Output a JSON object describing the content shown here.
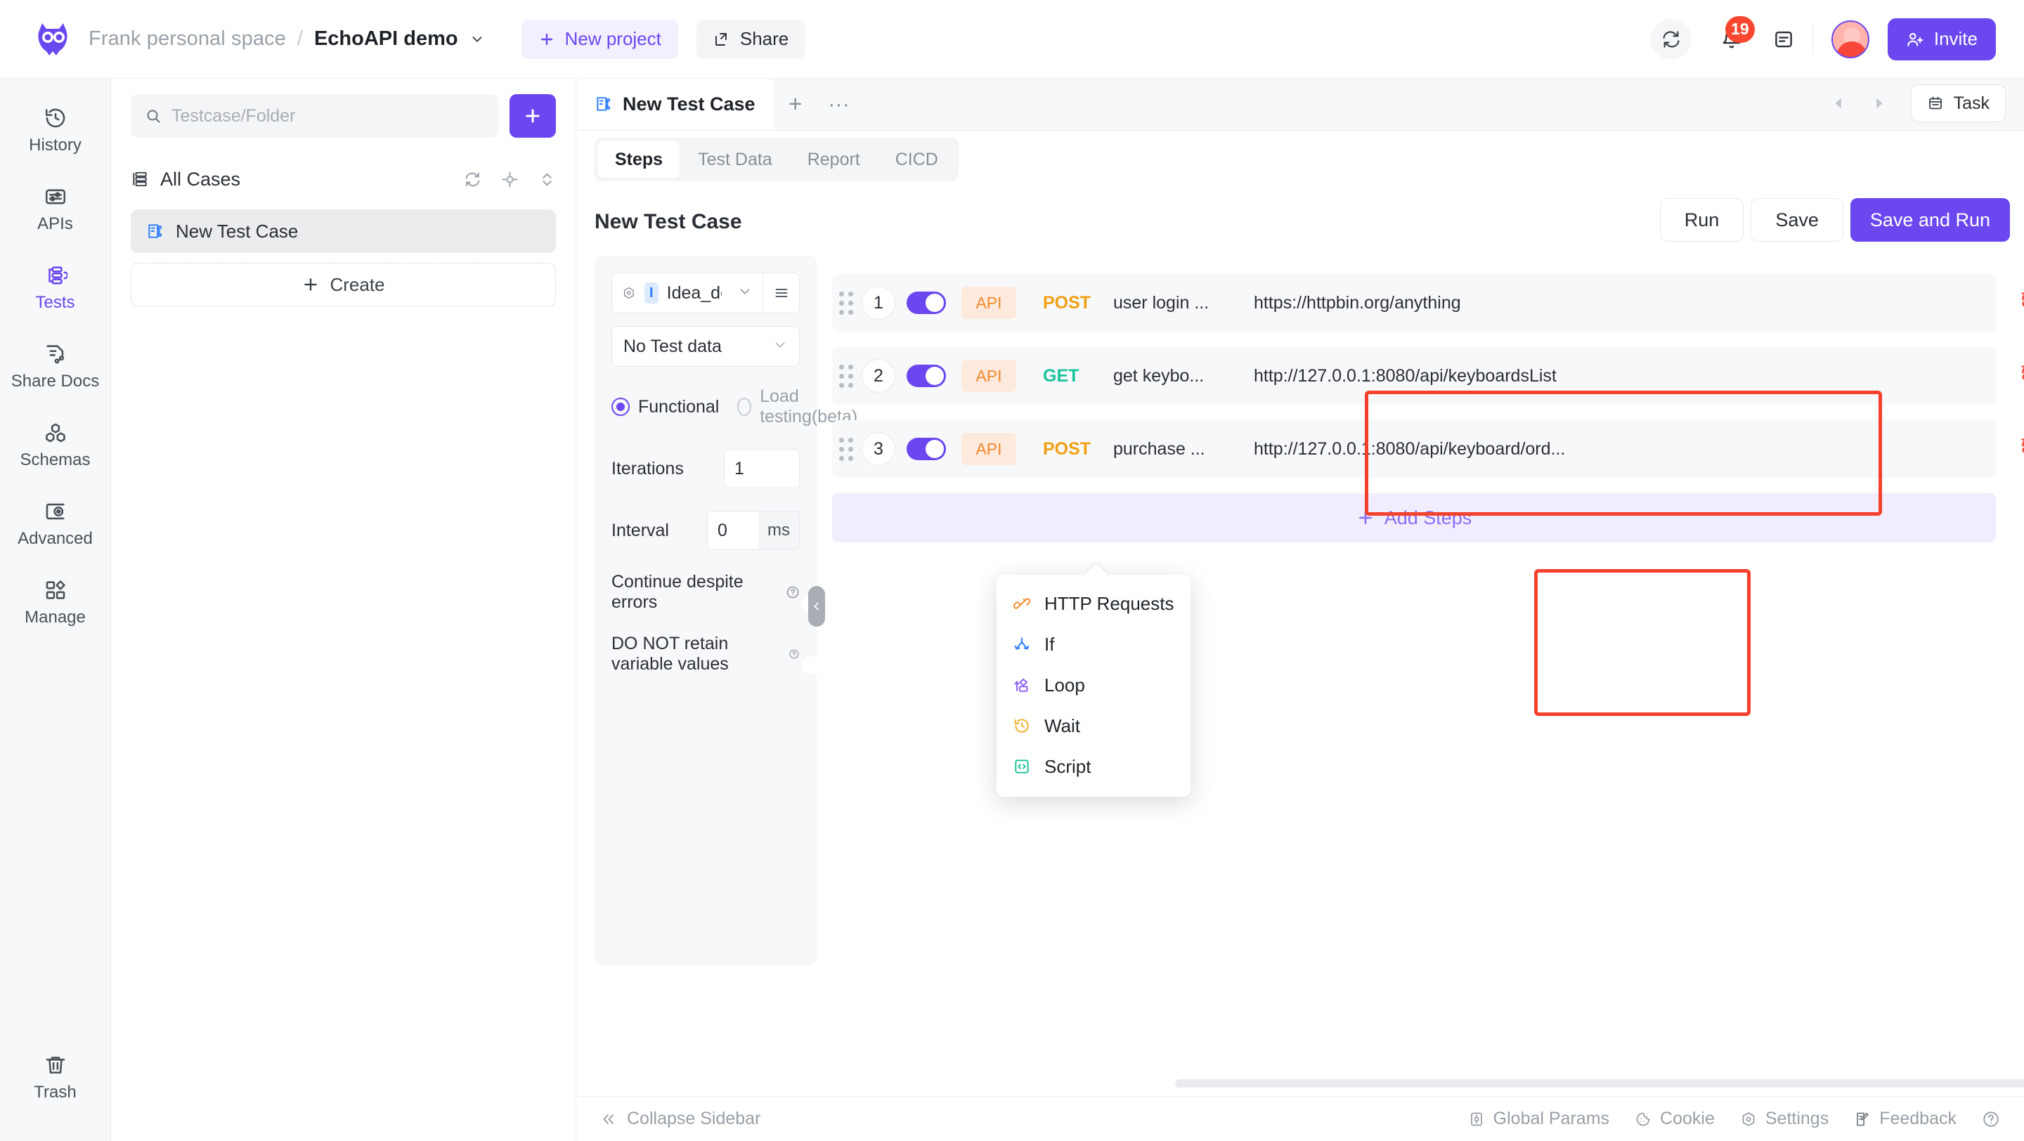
{
  "header": {
    "workspace": "Frank personal space",
    "separator": "/",
    "project": "EchoAPI demo",
    "new_project_label": "New project",
    "share_label": "Share",
    "invite_label": "Invite",
    "notification_count": "19",
    "icons": {
      "logo": "echoapi-owl-logo",
      "refresh": "refresh-icon",
      "bell": "bell-icon",
      "doc": "note-icon",
      "avatar": "user-avatar",
      "invite": "add-user-icon",
      "project_caret": "chevron-down-icon",
      "share": "share-icon",
      "plus": "plus-icon"
    }
  },
  "rail": {
    "items": [
      {
        "label": "History",
        "icon": "history-icon",
        "active": false
      },
      {
        "label": "APIs",
        "icon": "api-sliders-icon",
        "active": false
      },
      {
        "label": "Tests",
        "icon": "tests-flow-icon",
        "active": true
      },
      {
        "label": "Share Docs",
        "icon": "share-docs-icon",
        "active": false
      },
      {
        "label": "Schemas",
        "icon": "schemas-hex-icon",
        "active": false
      },
      {
        "label": "Advanced",
        "icon": "advanced-eye-icon",
        "active": false
      },
      {
        "label": "Manage",
        "icon": "manage-grid-icon",
        "active": false
      }
    ],
    "trash": {
      "label": "Trash",
      "icon": "trash-icon"
    }
  },
  "caselist": {
    "search_placeholder": "Testcase/Folder",
    "search_value": "",
    "add_label": "+",
    "group_title": "All Cases",
    "group_icon": "list-tree-icon",
    "actions": [
      "refresh-icon",
      "locate-icon",
      "sort-icon"
    ],
    "items": [
      {
        "name": "New Test Case",
        "icon": "testcase-icon",
        "selected": true
      }
    ],
    "create_label": "Create"
  },
  "main": {
    "doc_tab": {
      "title": "New Test Case",
      "icon": "testcase-icon"
    },
    "tab_plus": "+",
    "tab_dots": "···",
    "nav_prev": "prev-icon",
    "nav_next": "next-icon",
    "task_label": "Task",
    "task_icon": "calendar-icon",
    "subtabs": [
      {
        "label": "Steps",
        "active": true
      },
      {
        "label": "Test Data",
        "active": false
      },
      {
        "label": "Report",
        "active": false
      },
      {
        "label": "CICD",
        "active": false
      }
    ],
    "case_title": "New Test Case",
    "buttons": {
      "run": "Run",
      "save": "Save",
      "save_and_run": "Save and Run"
    }
  },
  "config": {
    "environment": {
      "badge": "I",
      "value": "Idea_dev",
      "icon": "env-hex-icon",
      "caret": "chevron-down-icon",
      "menu": "burger-icon"
    },
    "test_data": {
      "value": "No Test data",
      "caret": "chevron-down-icon"
    },
    "mode": [
      {
        "label": "Functional",
        "selected": true
      },
      {
        "label": "Load testing(beta)",
        "selected": false
      }
    ],
    "fields": [
      {
        "label": "Iterations",
        "value": "1",
        "unit": ""
      },
      {
        "label": "Interval",
        "value": "0",
        "unit": "ms"
      }
    ],
    "toggles": [
      {
        "label": "Continue despite errors",
        "help": "?",
        "on": false
      },
      {
        "label": "DO NOT retain variable values",
        "help": "?",
        "on": false
      }
    ],
    "collapse_handle_icon": "chevron-left-icon"
  },
  "steps": {
    "rows": [
      {
        "number": "1",
        "enabled": true,
        "type": "API",
        "method": "POST",
        "method_color": "#f0a012",
        "name": "user login ...",
        "url": "https://httpbin.org/anything",
        "unlink_icon": "unlink-icon"
      },
      {
        "number": "2",
        "enabled": true,
        "type": "API",
        "method": "GET",
        "method_color": "#19c39c",
        "name": "get keybo...",
        "url": "http://127.0.0.1:8080/api/keyboardsList",
        "unlink_icon": "unlink-icon"
      },
      {
        "number": "3",
        "enabled": true,
        "type": "API",
        "method": "POST",
        "method_color": "#f0a012",
        "name": "purchase ...",
        "url": "http://127.0.0.1:8080/api/keyboard/ord...",
        "unlink_icon": "unlink-icon"
      }
    ],
    "add_label": "Add Steps",
    "add_icon": "plus-icon"
  },
  "add_step_menu": {
    "items": [
      {
        "label": "HTTP Requests",
        "icon": "http-requests-icon",
        "color": "#f08a2a"
      },
      {
        "label": "If",
        "icon": "branch-if-icon",
        "color": "#2b7cff"
      },
      {
        "label": "Loop",
        "icon": "loop-icon",
        "color": "#8b5cf6"
      },
      {
        "label": "Wait",
        "icon": "wait-clock-icon",
        "color": "#f0b022"
      },
      {
        "label": "Script",
        "icon": "script-code-icon",
        "color": "#19c39c"
      }
    ]
  },
  "footer": {
    "collapse_label": "Collapse Sidebar",
    "collapse_icon": "double-chevron-left-icon",
    "items": [
      {
        "label": "Global Params",
        "icon": "global-params-icon"
      },
      {
        "label": "Cookie",
        "icon": "cookie-icon"
      },
      {
        "label": "Settings",
        "icon": "settings-icon"
      },
      {
        "label": "Feedback",
        "icon": "feedback-icon"
      }
    ],
    "help_icon": "help-circle-icon"
  },
  "colors": {
    "accent": "#6b47ef",
    "annotation": "#f5402c",
    "post": "#f0a012",
    "get": "#19c39c",
    "api_chip_bg": "#fdeadd",
    "api_chip_fg": "#f2892a"
  }
}
